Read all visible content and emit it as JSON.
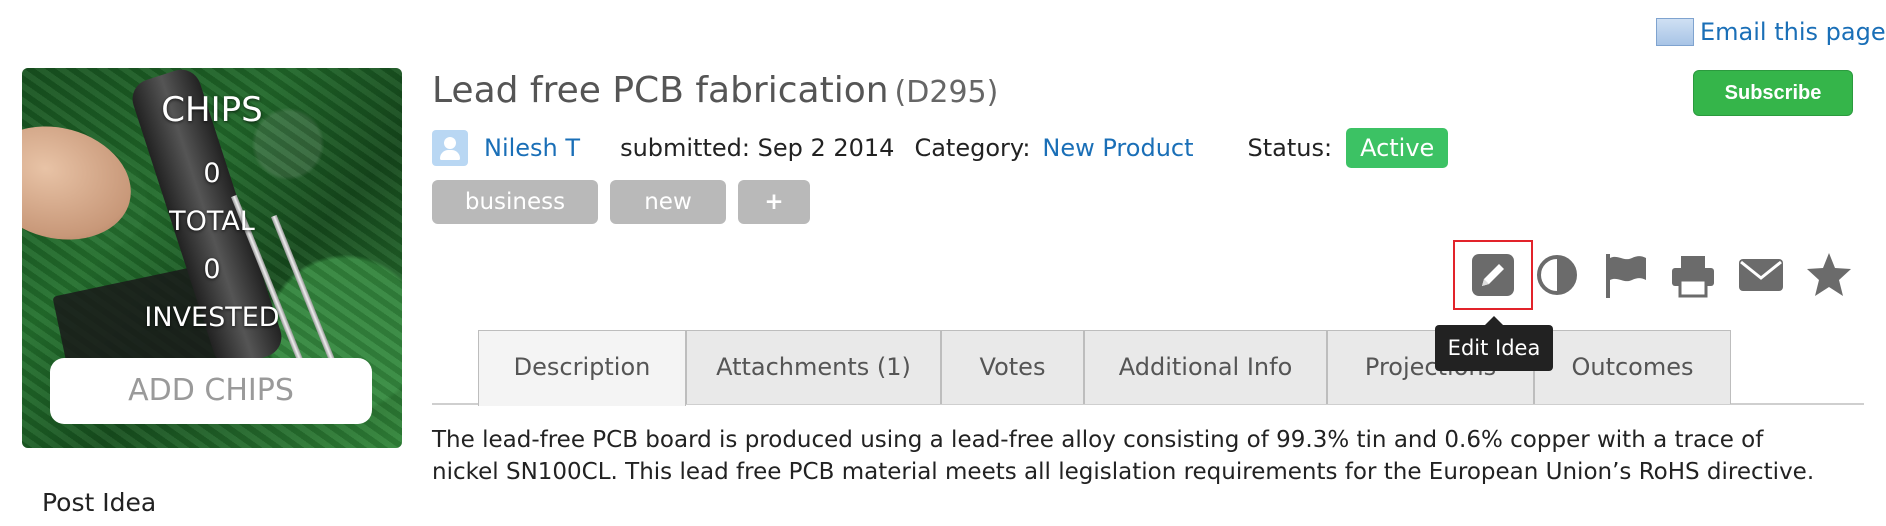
{
  "chips": {
    "title": "CHIPS",
    "total_value": "0",
    "total_label": "TOTAL",
    "invested_value": "0",
    "invested_label": "INVESTED",
    "add_button": "ADD CHIPS"
  },
  "sidebar": {
    "post_idea": "Post Idea"
  },
  "header": {
    "email_link": "Email this page",
    "subscribe": "Subscribe"
  },
  "idea": {
    "title": "Lead free PCB fabrication",
    "code": "(D295)",
    "author": "Nilesh T",
    "submitted": "submitted: Sep 2 2014",
    "category_label": "Category:",
    "category_value": "New Product",
    "status_label": "Status:",
    "status_value": "Active",
    "tags": [
      "business",
      "new",
      "+"
    ]
  },
  "toolbar": {
    "icons": [
      "pencil-icon",
      "contrast-icon",
      "flag-icon",
      "print-icon",
      "envelope-icon",
      "star-icon"
    ],
    "tooltip": "Edit Idea"
  },
  "tabs": [
    "Description",
    "Attachments (1)",
    "Votes",
    "Additional Info",
    "Projections",
    "Outcomes"
  ],
  "content": {
    "description_line1": "The lead-free PCB board is produced using a lead-free alloy consisting of 99.3% tin and 0.6% copper with a trace of",
    "description_line2": "nickel SN100CL. This lead free PCB material meets all legislation requirements for the European Union’s RoHS directive."
  },
  "colors": {
    "link": "#1a6fb7",
    "subscribe": "#35b54a",
    "status_active": "#3cc264",
    "tag": "#b9b9b9",
    "highlight": "#e2232a"
  }
}
